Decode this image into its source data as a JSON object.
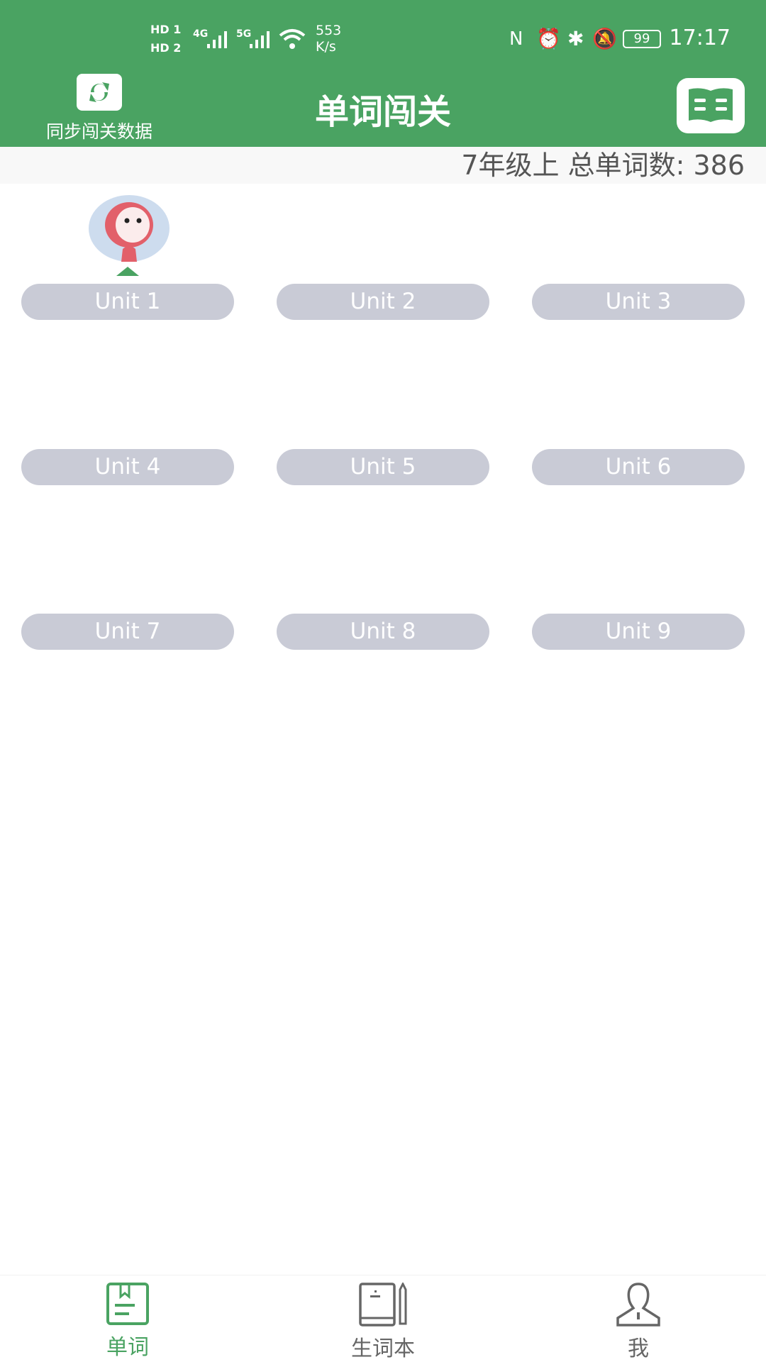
{
  "status_bar": {
    "sim1": "HD 1",
    "sim2": "HD 2",
    "net1": "4G",
    "net2": "5G",
    "speed_value": "553",
    "speed_unit": "K/s",
    "battery": "99",
    "time": "17:17",
    "icons": [
      "nfc-icon",
      "alarm-icon",
      "bluetooth-icon",
      "mute-bell-icon",
      "battery-icon"
    ]
  },
  "header": {
    "title": "单词闯关",
    "sync_label": "同步闯关数据",
    "sync_icon": "refresh-icon",
    "book_icon": "open-book-icon"
  },
  "summary": "7年级上 总单词数: 386",
  "colors": {
    "primary": "#4aa362",
    "pill": "#c9cbd6",
    "inactive": "#666666"
  },
  "units": [
    "Unit 1",
    "Unit 2",
    "Unit 3",
    "Unit 4",
    "Unit 5",
    "Unit 6",
    "Unit 7",
    "Unit 8",
    "Unit 9"
  ],
  "current_unit": "Unit 1",
  "nav": [
    {
      "label": "单词",
      "icon": "bookmark-book-icon",
      "active": true
    },
    {
      "label": "生词本",
      "icon": "notebook-pencil-icon",
      "active": false
    },
    {
      "label": "我",
      "icon": "person-icon",
      "active": false
    }
  ]
}
